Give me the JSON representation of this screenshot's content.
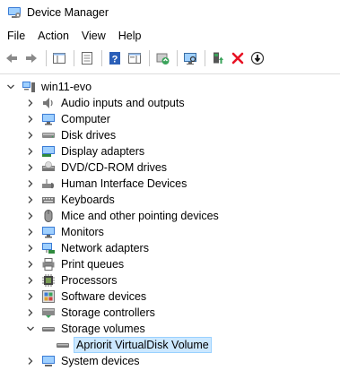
{
  "window": {
    "title": "Device Manager",
    "icon": "device-manager-icon"
  },
  "menu": [
    "File",
    "Action",
    "View",
    "Help"
  ],
  "toolbar": {
    "buttons": [
      "back-icon",
      "forward-icon",
      "show-hide-tree-icon",
      "properties-icon",
      "help-icon",
      "action-pane-icon",
      "update-driver-icon",
      "scan-hardware-icon",
      "enable-device-icon",
      "uninstall-device-icon",
      "disable-device-icon"
    ]
  },
  "tree": {
    "root": {
      "label": "win11-evo",
      "icon": "computer-icon",
      "expanded": true
    },
    "categories": [
      {
        "label": "Audio inputs and outputs",
        "icon": "speaker-icon",
        "expanded": false
      },
      {
        "label": "Computer",
        "icon": "monitor-icon",
        "expanded": false
      },
      {
        "label": "Disk drives",
        "icon": "disk-icon",
        "expanded": false
      },
      {
        "label": "Display adapters",
        "icon": "display-adapter-icon",
        "expanded": false
      },
      {
        "label": "DVD/CD-ROM drives",
        "icon": "dvd-icon",
        "expanded": false
      },
      {
        "label": "Human Interface Devices",
        "icon": "hid-icon",
        "expanded": false
      },
      {
        "label": "Keyboards",
        "icon": "keyboard-icon",
        "expanded": false
      },
      {
        "label": "Mice and other pointing devices",
        "icon": "mouse-icon",
        "expanded": false
      },
      {
        "label": "Monitors",
        "icon": "monitor-icon",
        "expanded": false
      },
      {
        "label": "Network adapters",
        "icon": "network-icon",
        "expanded": false
      },
      {
        "label": "Print queues",
        "icon": "printer-icon",
        "expanded": false
      },
      {
        "label": "Processors",
        "icon": "processor-icon",
        "expanded": false
      },
      {
        "label": "Software devices",
        "icon": "software-device-icon",
        "expanded": false
      },
      {
        "label": "Storage controllers",
        "icon": "storage-controller-icon",
        "expanded": false
      },
      {
        "label": "Storage volumes",
        "icon": "storage-volume-icon",
        "expanded": true,
        "children": [
          {
            "label": "Apriorit VirtualDisk Volume",
            "icon": "storage-volume-icon",
            "selected": true
          }
        ]
      },
      {
        "label": "System devices",
        "icon": "system-devices-icon",
        "expanded": false
      }
    ]
  },
  "colors": {
    "selection_bg": "#cce8ff",
    "selection_border": "#99d1ff",
    "uninstall_red": "#e81123",
    "help_blue": "#2b5fb8"
  }
}
